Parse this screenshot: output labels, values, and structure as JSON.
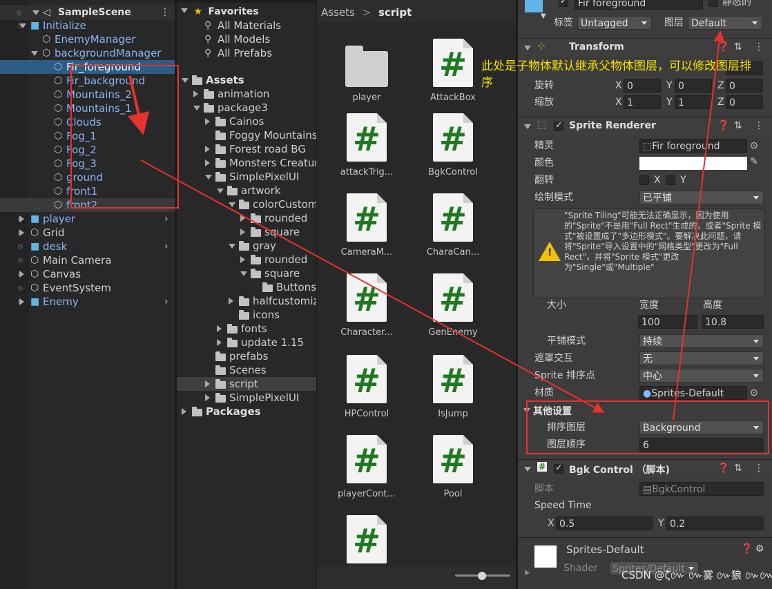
{
  "hierarchy": {
    "scene": "SampleScene",
    "rows": [
      {
        "label": "Initialize",
        "indent": 1,
        "kind": "prefab",
        "expand": "open"
      },
      {
        "label": "EnemyManager",
        "indent": 2,
        "kind": "prefab-child"
      },
      {
        "label": "backgroundManager",
        "indent": 2,
        "kind": "prefab-child",
        "expand": "open"
      },
      {
        "label": "Fir_foreground",
        "indent": 3,
        "kind": "prefab-child",
        "selected": true
      },
      {
        "label": "Fir_background",
        "indent": 3,
        "kind": "prefab-child"
      },
      {
        "label": "Mountains_2",
        "indent": 3,
        "kind": "prefab-child"
      },
      {
        "label": "Mountains_1",
        "indent": 3,
        "kind": "prefab-child"
      },
      {
        "label": "Clouds",
        "indent": 3,
        "kind": "prefab-child"
      },
      {
        "label": "Fog_1",
        "indent": 3,
        "kind": "prefab-child"
      },
      {
        "label": "Fog_2",
        "indent": 3,
        "kind": "prefab-child"
      },
      {
        "label": "Fog_3",
        "indent": 3,
        "kind": "prefab-child"
      },
      {
        "label": "ground",
        "indent": 3,
        "kind": "prefab-child"
      },
      {
        "label": "front1",
        "indent": 3,
        "kind": "prefab-child"
      },
      {
        "label": "front2",
        "indent": 3,
        "kind": "prefab-child",
        "hovered": true
      },
      {
        "label": "player",
        "indent": 1,
        "kind": "prefab",
        "expand": "closed",
        "arrow": true
      },
      {
        "label": "Grid",
        "indent": 1,
        "kind": "object",
        "expand": "closed"
      },
      {
        "label": "desk",
        "indent": 1,
        "kind": "prefab",
        "arrow": true
      },
      {
        "label": "Main Camera",
        "indent": 1,
        "kind": "object"
      },
      {
        "label": "Canvas",
        "indent": 1,
        "kind": "object",
        "expand": "closed"
      },
      {
        "label": "EventSystem",
        "indent": 1,
        "kind": "object"
      },
      {
        "label": "Enemy",
        "indent": 1,
        "kind": "prefab",
        "expand": "closed",
        "arrow": true
      }
    ]
  },
  "project": {
    "favorites_label": "Favorites",
    "favorites": [
      "All Materials",
      "All Models",
      "All Prefabs"
    ],
    "tree": [
      {
        "label": "Assets",
        "indent": 0,
        "expand": "open",
        "bold": true
      },
      {
        "label": "animation",
        "indent": 1,
        "expand": "closed"
      },
      {
        "label": "package3",
        "indent": 1,
        "expand": "open"
      },
      {
        "label": "Cainos",
        "indent": 2,
        "expand": "closed"
      },
      {
        "label": "Foggy Mountains",
        "indent": 2
      },
      {
        "label": "Forest road BG",
        "indent": 2,
        "expand": "closed"
      },
      {
        "label": "Monsters Creatures",
        "indent": 2,
        "expand": "closed"
      },
      {
        "label": "SimplePixelUI",
        "indent": 2,
        "expand": "open"
      },
      {
        "label": "artwork",
        "indent": 3,
        "expand": "open"
      },
      {
        "label": "colorCustomizable",
        "indent": 4,
        "expand": "open"
      },
      {
        "label": "rounded",
        "indent": 5,
        "expand": "closed"
      },
      {
        "label": "square",
        "indent": 5,
        "expand": "closed"
      },
      {
        "label": "gray",
        "indent": 4,
        "expand": "open"
      },
      {
        "label": "rounded",
        "indent": 5,
        "expand": "closed"
      },
      {
        "label": "square",
        "indent": 5,
        "expand": "open"
      },
      {
        "label": "Buttons",
        "indent": 6
      },
      {
        "label": "halfcustomizable",
        "indent": 4,
        "expand": "closed"
      },
      {
        "label": "icons",
        "indent": 4
      },
      {
        "label": "fonts",
        "indent": 3,
        "expand": "closed"
      },
      {
        "label": "update 1.15",
        "indent": 3,
        "expand": "closed"
      },
      {
        "label": "prefabs",
        "indent": 2
      },
      {
        "label": "Scenes",
        "indent": 2
      },
      {
        "label": "script",
        "indent": 2,
        "expand": "closed",
        "selected": true
      },
      {
        "label": "SimplePixelUI",
        "indent": 2,
        "expand": "closed"
      },
      {
        "label": "Packages",
        "indent": 0,
        "expand": "closed",
        "bold": true
      }
    ]
  },
  "assets_view": {
    "breadcrumb": [
      "Assets",
      "script"
    ],
    "breadcrumb_sep": ">",
    "items": [
      {
        "label": "player",
        "type": "folder"
      },
      {
        "label": "AttackBox",
        "type": "script"
      },
      {
        "label": "attackTrig...",
        "type": "script"
      },
      {
        "label": "BgkControl",
        "type": "script"
      },
      {
        "label": "CameraM...",
        "type": "script"
      },
      {
        "label": "CharaCan...",
        "type": "script"
      },
      {
        "label": "Character...",
        "type": "script"
      },
      {
        "label": "GenEnemy",
        "type": "script"
      },
      {
        "label": "HPControl",
        "type": "script"
      },
      {
        "label": "IsJump",
        "type": "script"
      },
      {
        "label": "playerCont...",
        "type": "script"
      },
      {
        "label": "Pool",
        "type": "script"
      },
      {
        "label": "",
        "type": "script"
      }
    ],
    "script_glyph": "#"
  },
  "inspector": {
    "object_name": "Fir foreground",
    "static_label": "静态的",
    "tag_label": "标签",
    "tag_value": "Untagged",
    "layer_label": "图层",
    "layer_value": "Default",
    "transform": {
      "title": "Transform",
      "rotation_label": "旋转",
      "scale_label": "缩放",
      "rot": {
        "x": "0",
        "y": "0",
        "z": "0"
      },
      "scale": {
        "x": "1",
        "y": "1",
        "z": "0"
      },
      "axis": {
        "x": "X",
        "y": "Y",
        "z": "Z"
      }
    },
    "sprite_renderer": {
      "title": "Sprite Renderer",
      "sprite_label": "精灵",
      "sprite_value": "Fir foreground",
      "color_label": "颜色",
      "color_value": "#ffffff",
      "flip_label": "翻转",
      "flip_x": "X",
      "flip_y": "Y",
      "draw_mode_label": "绘制模式",
      "draw_mode_value": "已平铺",
      "warning": "\"Sprite Tiling\"可能无法正确显示，因为使用的\"Sprite\"不是用\"Full Rect\"生成的，或者\"Sprite 模式\"被设置成了\"多边形模式\"。要解决此问题，请将\"Sprite\"导入设置中的\"网格类型\"更改为\"Full Rect\"，并将\"Sprite 模式\"更改为\"Single\"或\"Multiple\"",
      "size_label": "大小",
      "width_label": "宽度",
      "height_label": "高度",
      "width_value": "100",
      "height_value": "10.8",
      "tile_mode_label": "平铺模式",
      "tile_mode_value": "持续",
      "mask_label": "遮罩交互",
      "mask_value": "无",
      "sort_point_label": "Sprite 排序点",
      "sort_point_value": "中心",
      "material_label": "材质",
      "material_value": "Sprites-Default",
      "additional_label": "其他设置",
      "sorting_layer_label": "排序图层",
      "sorting_layer_value": "Background",
      "order_label": "图层顺序",
      "order_value": "6"
    },
    "bgk_control": {
      "title": "Bgk Control （脚本)",
      "script_label": "脚本",
      "script_value": "BgkControl",
      "speed_label": "Speed Time",
      "speed_x": "0.5",
      "speed_y": "0.2"
    },
    "material_preview": {
      "name": "Sprites-Default",
      "shader_label": "Shader",
      "shader_value": "Sprites/Default"
    }
  },
  "annotation": {
    "text": "此处是子物体默认继承父物体图层，可以修改图层排序",
    "watermark": "CSDN @ζ៚ ៚雾 ៚狼 ៚៚"
  },
  "colors": {
    "highlight": "#2c5d87",
    "prefab_text": "#8ab4f8",
    "annotation_red": "#e5322d",
    "annotation_yellow": "#f5e000"
  }
}
